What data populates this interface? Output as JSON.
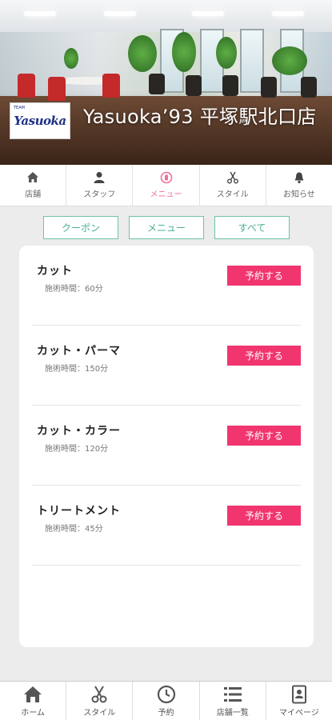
{
  "header": {
    "salon_name": "Yasuoka’93 平塚駅北口店",
    "logo_text": "Yasuoka",
    "logo_small": "TEAM"
  },
  "top_nav": [
    {
      "label": "店舗",
      "icon": "home-icon",
      "active": false
    },
    {
      "label": "スタッフ",
      "icon": "person-icon",
      "active": false
    },
    {
      "label": "メニュー",
      "icon": "menu-circle-icon",
      "active": true
    },
    {
      "label": "スタイル",
      "icon": "scissors-icon",
      "active": false
    },
    {
      "label": "お知らせ",
      "icon": "bell-icon",
      "active": false
    }
  ],
  "filters": [
    "クーポン",
    "メニュー",
    "すべて"
  ],
  "menu_items": [
    {
      "title": "カット",
      "time": "施術時間：60分",
      "button": "予約する"
    },
    {
      "title": "カット・パーマ",
      "time": "施術時間：150分",
      "button": "予約する"
    },
    {
      "title": "カット・カラー",
      "time": "施術時間：120分",
      "button": "予約する"
    },
    {
      "title": "トリートメント",
      "time": "施術時間：45分",
      "button": "予約する"
    }
  ],
  "bottom_nav": [
    {
      "label": "ホーム",
      "icon": "home-icon"
    },
    {
      "label": "スタイル",
      "icon": "scissors-icon"
    },
    {
      "label": "予約",
      "icon": "clock-icon"
    },
    {
      "label": "店舗一覧",
      "icon": "list-icon"
    },
    {
      "label": "マイページ",
      "icon": "id-card-icon"
    }
  ],
  "colors": {
    "accent_pink": "#f1356f",
    "active_tab": "#f06e9a",
    "filter_green": "#4aaf95"
  }
}
